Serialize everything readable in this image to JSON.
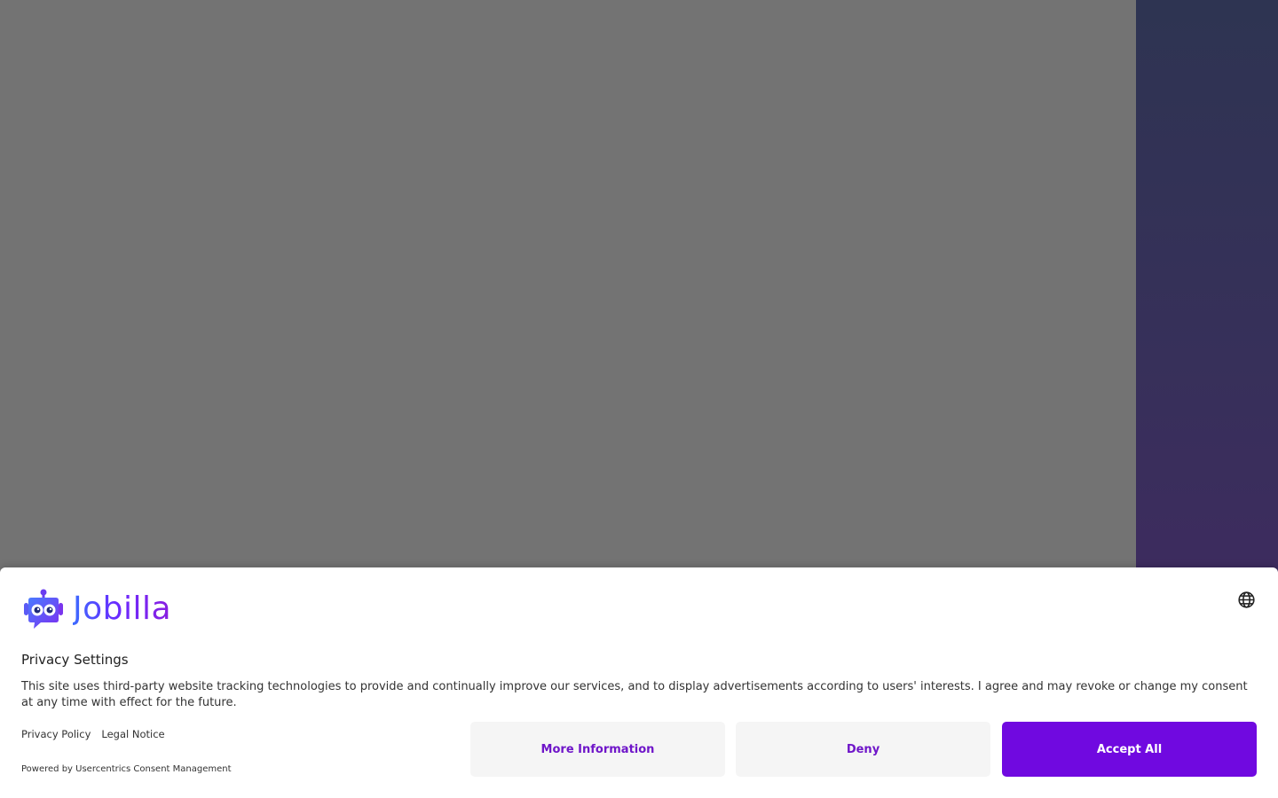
{
  "brand": {
    "name": "Jobilla",
    "logo_icon": "robot-mascot-icon",
    "accent_color": "#7009e0"
  },
  "consent": {
    "title": "Privacy Settings",
    "description": "This site uses third-party website tracking technologies to provide and continually improve our services, and to display advertisements according to users' interests. I agree and may revoke or change my consent at any time with effect for the future.",
    "links": {
      "privacy_policy": "Privacy Policy",
      "legal_notice": "Legal Notice"
    },
    "powered_by": "Powered by Usercentrics Consent Management",
    "language_icon": "globe-icon",
    "buttons": {
      "more_information": "More Information",
      "deny": "Deny",
      "accept_all": "Accept All"
    }
  },
  "colors": {
    "overlay": "#737373",
    "side_strip_top": "#2e3452",
    "side_strip_bottom": "#432763",
    "button_secondary_bg": "#f5f5f5",
    "button_secondary_text": "#6f16c9",
    "button_primary_bg": "#7009e0"
  }
}
